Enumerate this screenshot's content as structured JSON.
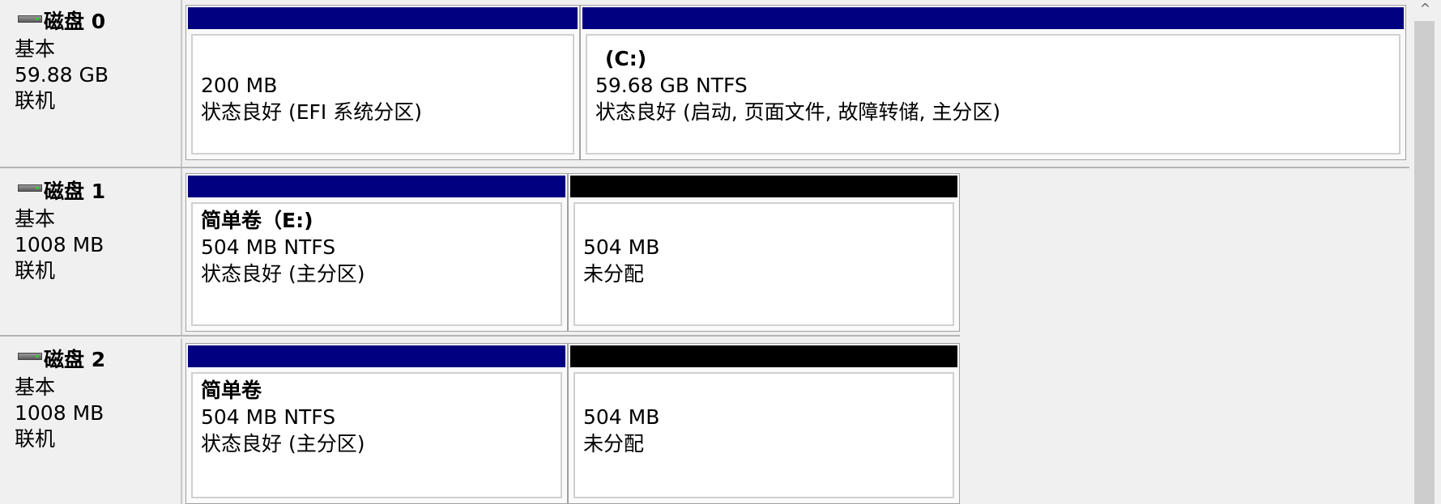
{
  "disks": [
    {
      "name": "磁盘 0",
      "type": "基本",
      "size": "59.88 GB",
      "status": "联机",
      "partitions": [
        {
          "label": "",
          "size": "200 MB",
          "state": "状态良好 (EFI 系统分区)",
          "bar_color": "#000080"
        },
        {
          "label": "(C:)",
          "size": "59.68 GB NTFS",
          "state": "状态良好 (启动, 页面文件, 故障转储, 主分区)",
          "bar_color": "#000080"
        }
      ]
    },
    {
      "name": "磁盘 1",
      "type": "基本",
      "size": "1008 MB",
      "status": "联机",
      "partitions": [
        {
          "label": "简单卷（E:)",
          "size": "504 MB NTFS",
          "state": "状态良好 (主分区)",
          "bar_color": "#000080"
        },
        {
          "label": "",
          "size": "504 MB",
          "state": "未分配",
          "bar_color": "#000000"
        }
      ]
    },
    {
      "name": "磁盘 2",
      "type": "基本",
      "size": "1008 MB",
      "status": "联机",
      "partitions": [
        {
          "label": "简单卷",
          "size": "504 MB NTFS",
          "state": "状态良好 (主分区)",
          "bar_color": "#000080"
        },
        {
          "label": "",
          "size": "504 MB",
          "state": "未分配",
          "bar_color": "#000000"
        }
      ]
    }
  ],
  "scrollbar": {
    "up_arrow": "^"
  }
}
